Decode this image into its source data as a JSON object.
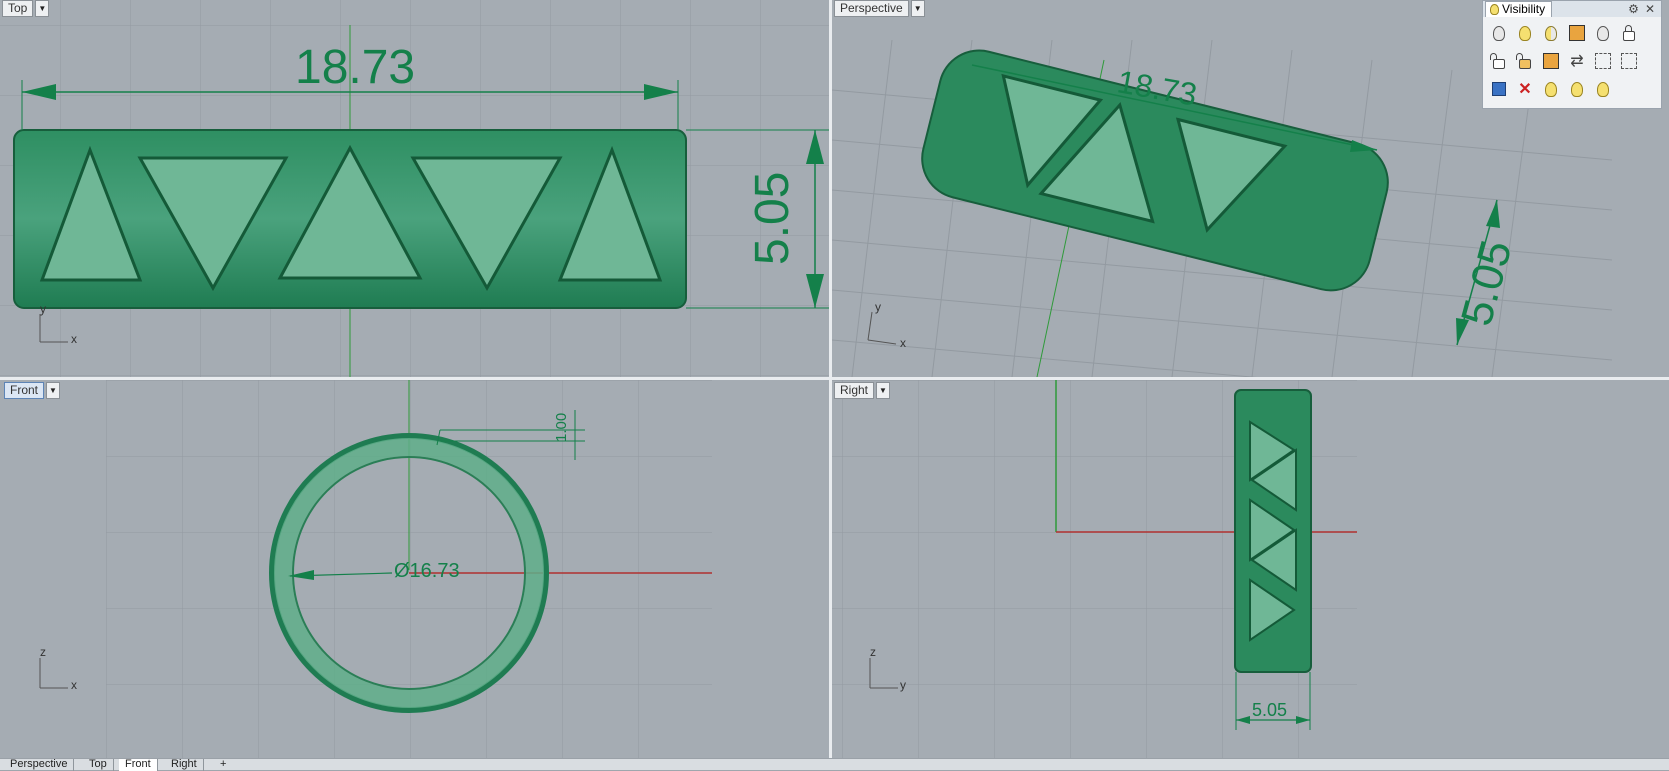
{
  "viewports": {
    "top": {
      "title": "Top",
      "dim_width": "18.73",
      "dim_height": "5.05",
      "axis_y": "y",
      "axis_x": "x"
    },
    "perspective": {
      "title": "Perspective",
      "dim_width": "18.73",
      "dim_height": "5.05",
      "axis_y": "y",
      "axis_x": "x"
    },
    "front": {
      "title": "Front",
      "dim_thickness": "1.00",
      "dim_diameter": "Ø16.73",
      "axis_z": "z",
      "axis_x": "x"
    },
    "right": {
      "title": "Right",
      "dim_width": "5.05",
      "axis_z": "z",
      "axis_y": "y"
    }
  },
  "visibility_panel": {
    "title": "Visibility",
    "buttons": [
      "show-icon",
      "show-selected-icon",
      "hide-icon",
      "hide-swap-icon",
      "show-objects-icon",
      "lock-icon",
      "unlock-icon",
      "unlock-selected-icon",
      "lock-swap-icon",
      "swap-icon",
      "select-hidden-icon",
      "select-locked-icon",
      "show-in-details-icon",
      "hide-in-details-icon",
      "show-bulb-icon",
      "show-bulb-2-icon",
      "show-bulb-3-icon"
    ]
  },
  "tabs": [
    "Perspective",
    "Top",
    "Front",
    "Right",
    "+"
  ],
  "active_tab": "Front",
  "colors": {
    "ring": "#1f8a5f",
    "dimension": "#14804a",
    "grid": "#9aa1a8",
    "x_axis": "#b03030",
    "y_axis": "#2f9a3a"
  }
}
